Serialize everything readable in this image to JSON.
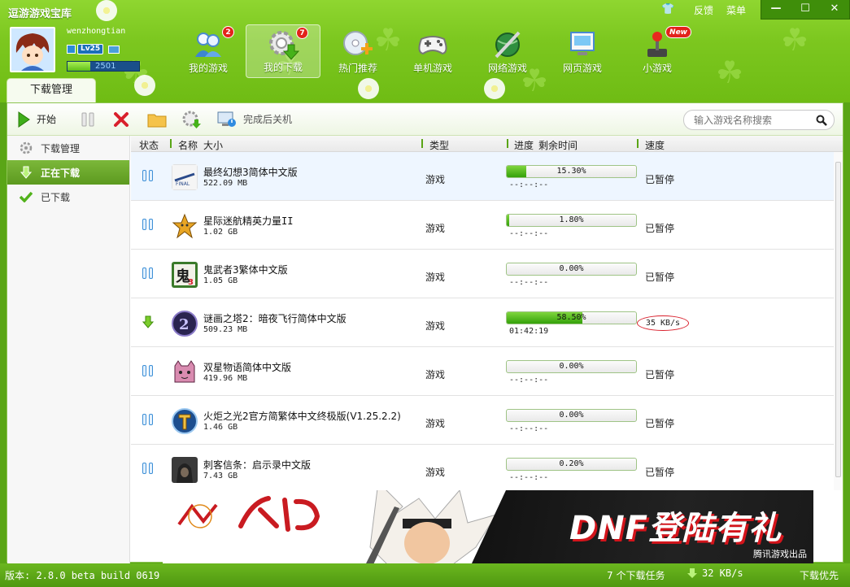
{
  "app": {
    "title": "逗游游戏宝库",
    "feedback_label": "反馈",
    "menu_label": "菜单",
    "minimize": "—",
    "maximize": "☐",
    "close": "✕"
  },
  "user": {
    "name": "wenzhongtian",
    "level": "Lv25",
    "points": "2501",
    "xp_progress_percent": 32
  },
  "nav": [
    {
      "id": "my-games",
      "label": "我的游戏",
      "badge": "2"
    },
    {
      "id": "my-downloads",
      "label": "我的下载",
      "badge": "7",
      "active": true
    },
    {
      "id": "hot",
      "label": "热门推荐"
    },
    {
      "id": "single",
      "label": "单机游戏"
    },
    {
      "id": "online",
      "label": "网络游戏"
    },
    {
      "id": "web",
      "label": "网页游戏"
    },
    {
      "id": "mini",
      "label": "小游戏",
      "badge": "New"
    }
  ],
  "tab": {
    "label": "下载管理"
  },
  "toolbar": {
    "start_label": "开始",
    "shutdown_label": "完成后关机",
    "search_placeholder": "输入游戏名称搜索"
  },
  "sidebar": {
    "items": [
      {
        "label": "下载管理"
      },
      {
        "label": "正在下载",
        "active": true
      },
      {
        "label": "已下载"
      }
    ]
  },
  "columns": {
    "status": "状态",
    "name": "名称",
    "size": "大小",
    "type": "类型",
    "progress": "进度",
    "remaining": "剩余时间",
    "speed": "速度"
  },
  "downloads": [
    {
      "name": "最终幻想3简体中文版",
      "size": "522.09 MB",
      "type": "游戏",
      "progress_percent": 15.3,
      "progress_text": "15.30%",
      "remaining": "--:--:--",
      "speed": "已暂停",
      "state": "paused",
      "selected": true
    },
    {
      "name": "星际迷航精英力量II",
      "size": "1.02 GB",
      "type": "游戏",
      "progress_percent": 1.8,
      "progress_text": "1.80%",
      "remaining": "--:--:--",
      "speed": "已暂停",
      "state": "paused"
    },
    {
      "name": "鬼武者3繁体中文版",
      "size": "1.05 GB",
      "type": "游戏",
      "progress_percent": 0,
      "progress_text": "0.00%",
      "remaining": "--:--:--",
      "speed": "已暂停",
      "state": "paused"
    },
    {
      "name": "谜画之塔2：暗夜飞行简体中文版",
      "size": "509.23 MB",
      "type": "游戏",
      "progress_percent": 58.5,
      "progress_text": "58.50%",
      "remaining": "01:42:19",
      "speed": "35 KB/s",
      "state": "downloading"
    },
    {
      "name": "双星物语简体中文版",
      "size": "419.96 MB",
      "type": "游戏",
      "progress_percent": 0,
      "progress_text": "0.00%",
      "remaining": "--:--:--",
      "speed": "已暂停",
      "state": "paused"
    },
    {
      "name": "火炬之光2官方简繁体中文终极版(V1.25.2.2)",
      "size": "1.46 GB",
      "type": "游戏",
      "progress_percent": 0,
      "progress_text": "0.00%",
      "remaining": "--:--:--",
      "speed": "已暂停",
      "state": "paused"
    },
    {
      "name": "刺客信条：启示录中文版",
      "size": "7.43 GB",
      "type": "游戏",
      "progress_percent": 0.2,
      "progress_text": "0.20%",
      "remaining": "--:--:--",
      "speed": "已暂停",
      "state": "paused"
    }
  ],
  "banner": {
    "slogan": "DNF登陆有礼",
    "credit": "腾讯游戏出品"
  },
  "status": {
    "version": "版本: 2.8.0 beta build 0619",
    "task_count": "7 个下载任务",
    "total_speed": "32 KB/s",
    "priority": "下载优先"
  },
  "colors": {
    "brand_green": "#6fbc14",
    "progress_green": "#34a10a",
    "accent_blue": "#3d8fd6",
    "alert_red": "#d9202c"
  }
}
